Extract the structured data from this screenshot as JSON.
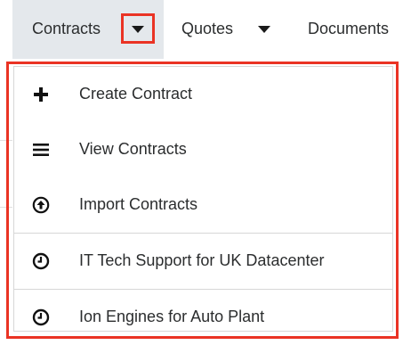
{
  "nav": {
    "tabs": [
      {
        "label": "Contracts",
        "active": true,
        "has_dropdown": true
      },
      {
        "label": "Quotes",
        "active": false,
        "has_dropdown": true
      },
      {
        "label": "Documents",
        "active": false,
        "has_dropdown": false
      }
    ]
  },
  "menu": {
    "items": [
      {
        "label": "Create Contract",
        "icon": "plus-icon"
      },
      {
        "label": "View Contracts",
        "icon": "list-icon"
      },
      {
        "label": "Import Contracts",
        "icon": "upload-circle-icon"
      },
      {
        "label": "IT Tech Support for UK Datacenter",
        "icon": "clock-icon"
      },
      {
        "label": "Ion Engines for Auto Plant",
        "icon": "clock-icon"
      }
    ]
  },
  "colors": {
    "highlight": "#ea3324",
    "active_tab_bg": "#e4e8ec",
    "text": "#2b2d2e",
    "divider": "#d7d7d7"
  }
}
